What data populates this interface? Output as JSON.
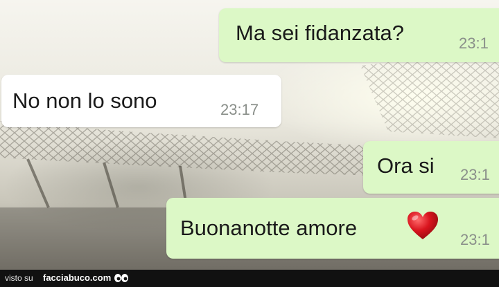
{
  "messages": [
    {
      "direction": "outgoing",
      "text": "Ma sei fidanzata?",
      "time": "23:1"
    },
    {
      "direction": "incoming",
      "text": "No non lo sono",
      "time": "23:17"
    },
    {
      "direction": "outgoing",
      "text": "Ora si",
      "time": "23:1"
    },
    {
      "direction": "outgoing",
      "text": "Buonanotte amore",
      "time": "23:1",
      "emoji": "heart-icon"
    }
  ],
  "footer": {
    "prefix": "visto su",
    "site": "facciabuco.com",
    "icon": "eyes-icon"
  },
  "colors": {
    "outgoing_bubble": "#dcf8c6",
    "incoming_bubble": "#ffffff",
    "timestamp": "#8a8f8a",
    "heart": "#d9141e",
    "footer_bg": "#111111"
  }
}
